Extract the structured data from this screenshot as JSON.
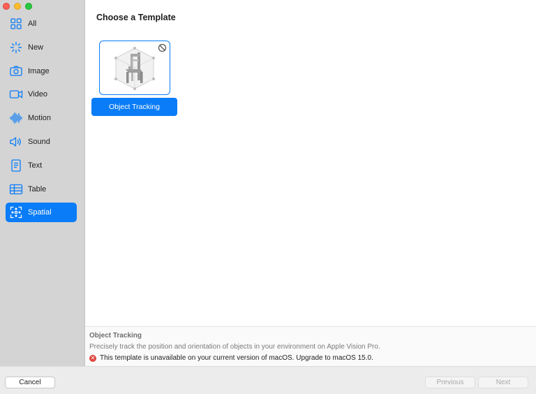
{
  "window": {
    "traffic_lights": [
      "close",
      "minimize",
      "zoom"
    ]
  },
  "sidebar": {
    "items": [
      {
        "label": "All",
        "icon": "grid-icon"
      },
      {
        "label": "New",
        "icon": "sparkle-icon"
      },
      {
        "label": "Image",
        "icon": "camera-icon"
      },
      {
        "label": "Video",
        "icon": "video-icon"
      },
      {
        "label": "Motion",
        "icon": "waveform-icon"
      },
      {
        "label": "Sound",
        "icon": "speaker-icon"
      },
      {
        "label": "Text",
        "icon": "document-icon"
      },
      {
        "label": "Table",
        "icon": "table-icon"
      },
      {
        "label": "Spatial",
        "icon": "spatial-icon",
        "selected": true
      }
    ]
  },
  "main": {
    "title": "Choose a Template",
    "templates": [
      {
        "label": "Object Tracking",
        "icon": "chair-object-icon",
        "unavailable": true,
        "selected": true
      }
    ]
  },
  "description": {
    "title": "Object Tracking",
    "text": "Precisely track the position and orientation of objects in your environment on Apple Vision Pro.",
    "warning": "This template is unavailable on your current version of macOS. Upgrade to macOS 15.0."
  },
  "footer": {
    "cancel_label": "Cancel",
    "previous_label": "Previous",
    "next_label": "Next"
  },
  "colors": {
    "accent": "#0a7cf7",
    "sidebar_bg": "#d4d4d4",
    "error": "#e0443e"
  }
}
